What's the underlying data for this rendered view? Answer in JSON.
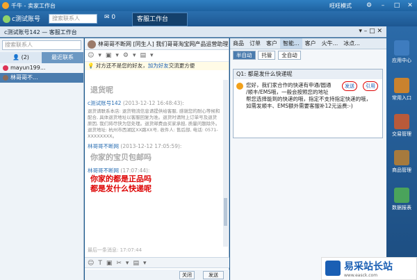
{
  "app": {
    "title": "千牛 - 卖家工作台",
    "mode_label": "旺旺模式"
  },
  "nav": {
    "account": "c测试账号",
    "search_placeholder": "搜索联系人",
    "msg_count": "0",
    "tab": "客服工作台"
  },
  "header2": {
    "title": "c测试账号142 — 客服工作台"
  },
  "left": {
    "search_placeholder": "搜索联系人",
    "tab_count": "(2)",
    "tab_recent": "最近联系",
    "contacts": [
      "mayun199...",
      "林哥哥不..."
    ]
  },
  "chat": {
    "contact": "林哥哥不断网 [同生人] 我们哥哥淘宝网产品运营助理",
    "notice": "对方还不是您的好友，",
    "notice_link": "加为好友",
    "notice_tail": "交流更方便",
    "m1_big": "退货呢",
    "m2_meta": "c测试账号142",
    "m2_time": "(2013-12-12 16:48:43):",
    "m2_body": "退货请联系本店: 退货物流信息请提供给客服, 感谢您的耐心等候和配合, 具体退货地址以客服回复为准。退货时请附上订单号及退货原因, 我们将尽快为您处理。退货邮费由买家承担, 质量问题除外。退货地址: 杭州市西湖区XX路XX号, 收件人: 售后部, 电话: 0571-XXXXXXXX。",
    "m3_meta": "林哥哥不断网",
    "m3_time": "(2013-12-12 17:05:59):",
    "m3_big": "你家的宝贝包邮吗",
    "m4_meta": "林哥哥不断网",
    "m4_time": "(17:07:44):",
    "m4_red1": "你家的都是正品吗",
    "m4_red2": "都是发什么快递呢",
    "history": "最后一条消息: 17:07:44",
    "close_btn": "关闭",
    "send_btn": "发送"
  },
  "right": {
    "tabs": [
      "商品",
      "订单",
      "客户",
      "智能...",
      "客户",
      "火牛...",
      "冰点..."
    ],
    "modes": [
      "半自动",
      "托管",
      "全自动"
    ],
    "question": "Q1: 都是发什么快递呢",
    "answer_l1": "您好，我们家合作的快递有申通/圆通",
    "answer_l2": "/顺丰/EMS哦，一般会按照您的地址",
    "answer_l3": "帮您选择能到的快递的哦，指定不支持指定快递的哦，",
    "answer_l4": "如需发顺丰、EMS额外需要客服补12元运费:-)",
    "send": "发送",
    "cite": "引用"
  },
  "sidebar": [
    "应用中心",
    "常用入口",
    "交易管理",
    "商品管理",
    "数据报表"
  ],
  "watermark": {
    "text": "易采站长站",
    "url": "www.easck.com"
  }
}
